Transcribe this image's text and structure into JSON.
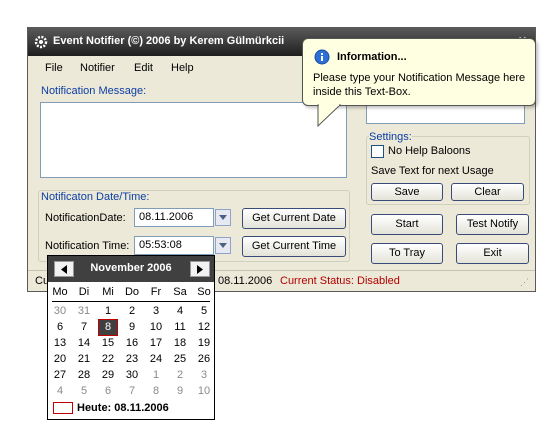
{
  "window": {
    "title": "Event Notifier (©) 2006 by Kerem Gülmürkcii",
    "menu": [
      "File",
      "Notifier",
      "Edit",
      "Help"
    ]
  },
  "notification": {
    "message_label": "Notification Message:",
    "message_value": ""
  },
  "datetime": {
    "group_label": "Notificaton Date/Time:",
    "date_label": "NotificationDate:",
    "date_value": "08.11.2006",
    "get_date_button": "Get Current Date",
    "time_label": "Notification Time:",
    "time_value": "05:53:08",
    "get_time_button": "Get Current Time"
  },
  "settings": {
    "group_label": "Settings:",
    "no_help_balloons": "No Help Baloons",
    "no_help_balloons_checked": false,
    "save_text_label": "Save Text for next Usage",
    "save_button": "Save",
    "clear_button": "Clear"
  },
  "actions": {
    "start_button": "Start",
    "test_notify_button": "Test Notify",
    "to_tray_button": "To Tray",
    "exit_button": "Exit"
  },
  "status": {
    "left_fragment": "Cu",
    "date_fragment": "08.11.2006",
    "status_text": "Current Status: Disabled",
    "status_color": "#b00000"
  },
  "balloon": {
    "title": "Information...",
    "text": "Please type your Notification Message here inside this Text-Box.",
    "icon": "info-icon"
  },
  "calendar": {
    "month_label": "November 2006",
    "weekdays": [
      "Mo",
      "Di",
      "Mi",
      "Do",
      "Fr",
      "Sa",
      "So"
    ],
    "weeks": [
      [
        "30",
        "31",
        "1",
        "2",
        "3",
        "4",
        "5"
      ],
      [
        "6",
        "7",
        "8",
        "9",
        "10",
        "11",
        "12"
      ],
      [
        "13",
        "14",
        "15",
        "16",
        "17",
        "18",
        "19"
      ],
      [
        "20",
        "21",
        "22",
        "23",
        "24",
        "25",
        "26"
      ],
      [
        "27",
        "28",
        "29",
        "30",
        "1",
        "2",
        "3"
      ],
      [
        "4",
        "5",
        "6",
        "7",
        "8",
        "9",
        "10"
      ]
    ],
    "dim": [
      [
        true,
        true,
        false,
        false,
        false,
        false,
        false
      ],
      [
        false,
        false,
        false,
        false,
        false,
        false,
        false
      ],
      [
        false,
        false,
        false,
        false,
        false,
        false,
        false
      ],
      [
        false,
        false,
        false,
        false,
        false,
        false,
        false
      ],
      [
        false,
        false,
        false,
        false,
        true,
        true,
        true
      ],
      [
        true,
        true,
        true,
        true,
        true,
        true,
        true
      ]
    ],
    "selected_day": "8",
    "today_label": "Heute: 08.11.2006"
  }
}
